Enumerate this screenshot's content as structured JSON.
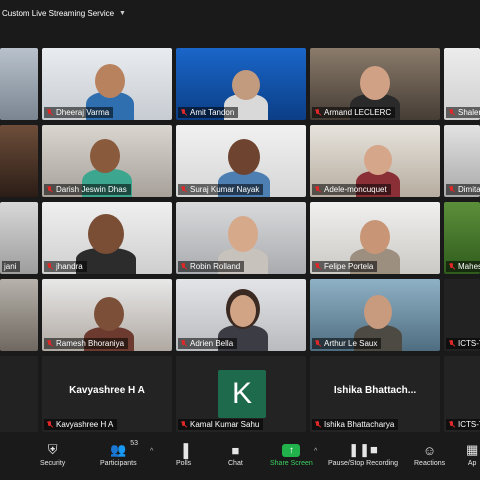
{
  "topbar": {
    "stream_label": "Custom Live Streaming Service"
  },
  "tiles": {
    "dheeraj": "Dheeraj Varma",
    "amit": "Amit Tandon",
    "armand": "Armand LECLERC",
    "shalen": "Shaler",
    "darish": "Darish Jeswin Dhas",
    "suraj": "Suraj Kumar Nayak",
    "adele": "Adele-moncuquet",
    "dimita": "Dimita",
    "jani": "jani",
    "jhandra": "jhandra",
    "robin": "Robin Rolland",
    "felipe": "Felipe Portela",
    "mahes": "Mahes",
    "ramesh": "Ramesh Bhoraniya",
    "adrien": "Adrien Bella",
    "arthur": "Arthur Le Saux",
    "ictst1": "ICTS-T",
    "kavya_center": "Kavyashree H A",
    "kavya": "Kavyashree H A",
    "kamal_avatar": "K",
    "kamal": "Kamal Kumar Sahu",
    "ishika_center": "Ishika  Bhattach...",
    "ishika": "Ishika Bhattacharya",
    "ictst2": "ICTS-T"
  },
  "toolbar": {
    "security": "Security",
    "participants": "Participants",
    "participants_count": "53",
    "polls": "Polls",
    "chat": "Chat",
    "share": "Share Screen",
    "recording": "Pause/Stop Recording",
    "reactions": "Reactions",
    "apps": "Ap"
  },
  "colors": {
    "share_green": "#22b24c",
    "mute_red": "#e02828",
    "avatar_green": "#1e6a4d"
  }
}
